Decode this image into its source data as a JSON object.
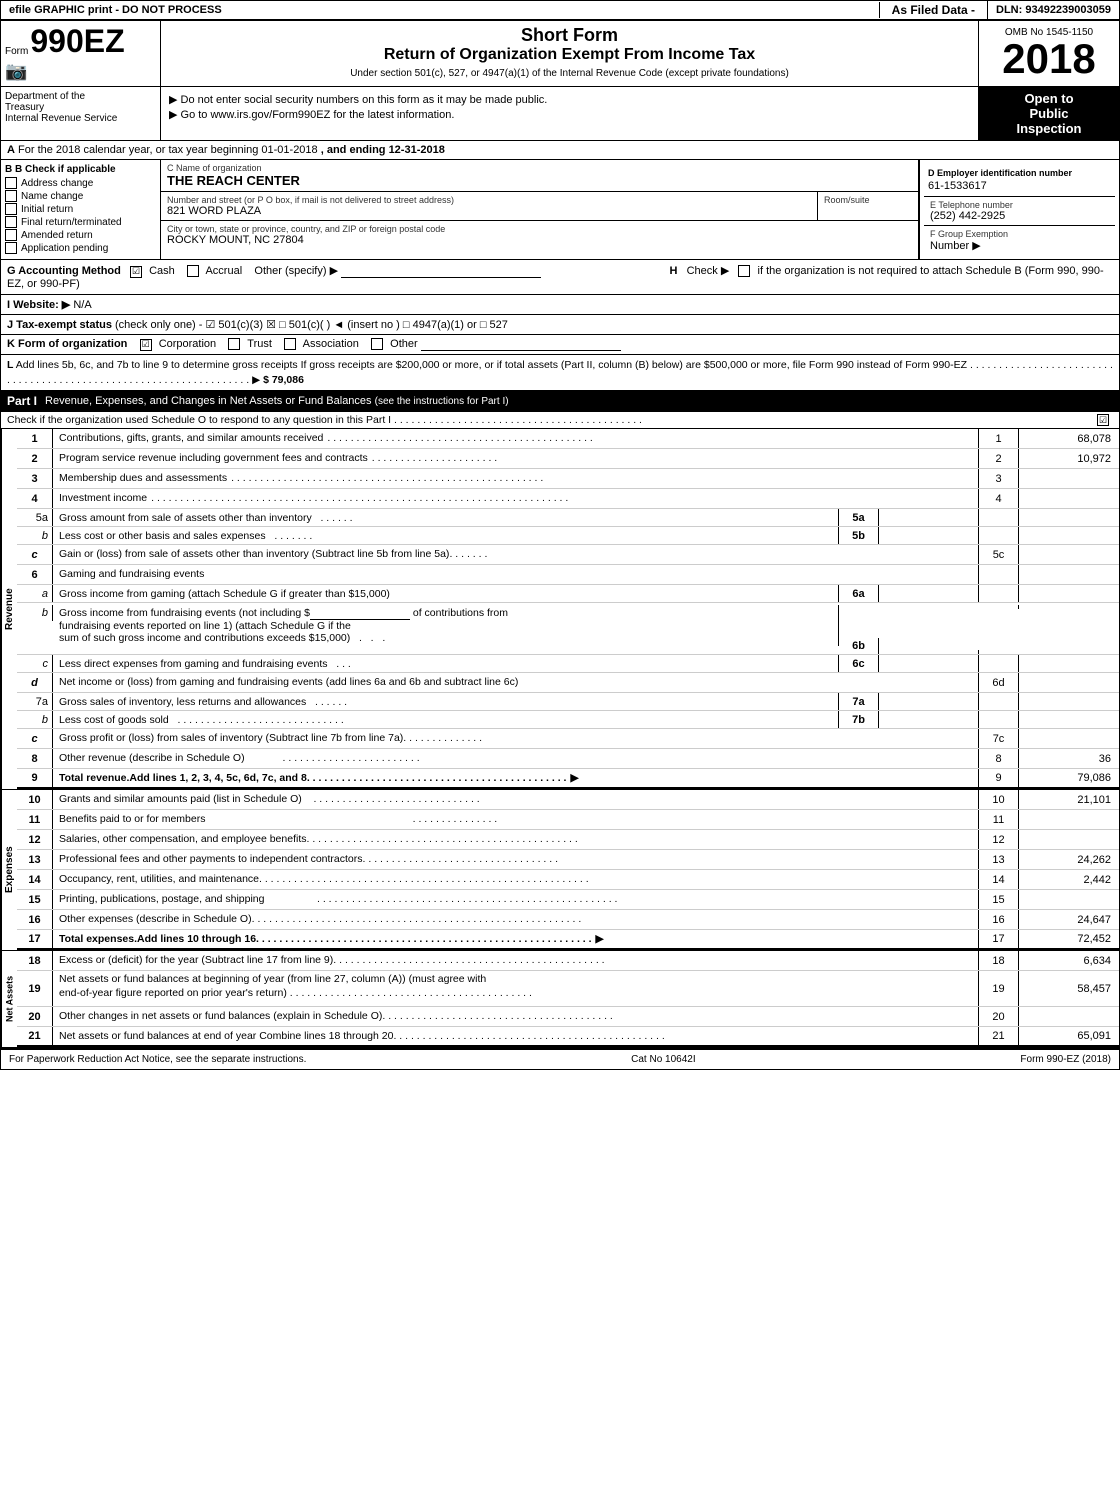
{
  "header": {
    "left_text": "efile GRAPHIC print - DO NOT PROCESS",
    "mid_text": "As Filed Data -",
    "dln": "DLN: 93492239003059"
  },
  "form": {
    "form_label": "Form",
    "form_number": "990EZ",
    "short_form": "Short Form",
    "return_title": "Return of Organization Exempt From Income Tax",
    "subtitle": "Under section 501(c), 527, or 4947(a)(1) of the Internal Revenue Code (except private foundations)",
    "omb_label": "OMB No 1545-1150",
    "year": "2018",
    "open_to": "Open to",
    "public": "Public",
    "inspection": "Inspection"
  },
  "notices": {
    "ssn_notice": "▶ Do not enter social security numbers on this form as it may be made public.",
    "irs_link": "▶ Go to www.irs.gov/Form990EZ for the latest information."
  },
  "section_a": {
    "label": "A",
    "text": "For the 2018 calendar year, or tax year beginning 01-01-2018",
    "ending": ", and ending 12-31-2018"
  },
  "check_applicable": {
    "label": "B Check if applicable",
    "items": [
      {
        "label": "Address change",
        "checked": false
      },
      {
        "label": "Name change",
        "checked": false
      },
      {
        "label": "Initial return",
        "checked": false
      },
      {
        "label": "Final return/terminated",
        "checked": false
      },
      {
        "label": "Amended return",
        "checked": false
      },
      {
        "label": "Application pending",
        "checked": false
      }
    ]
  },
  "org": {
    "name_label": "C Name of organization",
    "name": "THE REACH CENTER",
    "address_label": "Number and street (or P O box, if mail is not delivered to street address)",
    "address": "821 WORD PLAZA",
    "room_label": "Room/suite",
    "room": "",
    "city_label": "City or town, state or province, country, and ZIP or foreign postal code",
    "city": "ROCKY MOUNT, NC  27804",
    "ein_label": "D Employer identification number",
    "ein": "61-1533617",
    "phone_label": "E Telephone number",
    "phone": "(252) 442-2925",
    "fgroup_label": "F Group Exemption",
    "fgroup_num": "Number",
    "fgroup_arrow": "▶"
  },
  "accounting": {
    "g_label": "G Accounting Method",
    "cash_label": "Cash",
    "accrual_label": "Accrual",
    "other_label": "Other (specify) ▶",
    "cash_checked": true,
    "accrual_checked": false,
    "h_label": "H",
    "h_text": "Check ▶",
    "h_desc": "if the organization is not required to attach Schedule B (Form 990, 990-EZ, or 990-PF)"
  },
  "website": {
    "label": "I Website: ▶",
    "value": "N/A"
  },
  "tax_exempt": {
    "j_label": "J Tax-exempt status",
    "j_text": "(check only one) - ☑ 501(c)(3) ☒ □ 501(c)(  ) ◄ (insert no ) □ 4947(a)(1) or □ 527"
  },
  "form_org": {
    "k_label": "K Form of organization",
    "corporation": "Corporation",
    "trust": "Trust",
    "association": "Association",
    "other": "Other",
    "corp_checked": true
  },
  "add_lines": {
    "l_label": "L",
    "l_text": "Add lines 5b, 6c, and 7b to line 9 to determine gross receipts If gross receipts are $200,000 or more, or if total assets (Part II, column (B) below) are $500,000 or more, file Form 990 instead of Form 990-EZ",
    "l_dots": ". . . . . . . . . . . . . . . . . . . . . . . . . . . . . . . . . . . . . . . . . . . . . . . . . . . . . . . . . . . . . . . . . . .",
    "l_arrow": "▶",
    "l_value": "$ 79,086"
  },
  "part1": {
    "label": "Part I",
    "title": "Revenue, Expenses, and Changes in Net Assets or Fund Balances",
    "title_note": "(see the instructions for Part I)",
    "schedule_o_text": "Check if the organization used Schedule O to respond to any question in this Part I",
    "schedule_o_dots": ". . . . . . . . . . . . . . . . . . . . . . . . . . . . . . . . . . . . . . . . . . .",
    "schedule_o_checked": true
  },
  "revenue_rows": [
    {
      "num": "1",
      "desc": "Contributions, gifts, grants, and similar amounts received",
      "dots": ". . . . . . . . . . . . . . . . . . . . . . . . . . . . . . . .",
      "line_num": "1",
      "value": "68,078"
    },
    {
      "num": "2",
      "desc": "Program service revenue including government fees and contracts",
      "dots": ". . . . . . . . . . . . . . . . . . . . . . . .",
      "line_num": "2",
      "value": "10,972"
    },
    {
      "num": "3",
      "desc": "Membership dues and assessments",
      "dots": ". . . . . . . . . . . . . . . . . . . . . . . . . . . . . . . . . . . . . . . . . . . . . . . . . . . . . . . . .",
      "line_num": "3",
      "value": ""
    },
    {
      "num": "4",
      "desc": "Investment income",
      "dots": ". . . . . . . . . . . . . . . . . . . . . . . . . . . . . . . . . . . . . . . . . . . . . . . . . . . . . . . . . . . . . . . . . . . . . . . . .",
      "line_num": "4",
      "value": ""
    }
  ],
  "row_5a": {
    "num": "5a",
    "desc": "Gross amount from sale of assets other than inventory",
    "label": "5a",
    "value": ""
  },
  "row_5b": {
    "num": "b",
    "desc": "Less  cost or other basis and sales expenses",
    "label": "5b",
    "value": ""
  },
  "row_5c": {
    "num": "c",
    "desc": "Gain or (loss) from sale of assets other than inventory (Subtract line 5b from line 5a)",
    "dots": ". . . . . . . .",
    "line_num": "5c",
    "value": ""
  },
  "row_6": {
    "num": "6",
    "desc": "Gaming and fundraising events"
  },
  "row_6a": {
    "num": "a",
    "desc": "Gross income from gaming (attach Schedule G if greater than $15,000)",
    "label": "6a",
    "value": ""
  },
  "row_6b_text": "Gross income from fundraising events (not including $",
  "row_6b_text2": "of contributions from",
  "row_6b_text3": "fundraising events reported on line 1) (attach Schedule G if the",
  "row_6b_text4": "sum of such gross income and contributions exceeds $15,000)",
  "row_6b_label": "6b",
  "row_6c": {
    "num": "c",
    "desc": "Less  direct expenses from gaming and fundraising events",
    "dots": ". . .",
    "label": "6c",
    "value": ""
  },
  "row_6d": {
    "num": "d",
    "desc": "Net income or (loss) from gaming and fundraising events (add lines 6a and 6b and subtract line 6c)",
    "line_num": "6d",
    "value": ""
  },
  "row_7a": {
    "num": "7a",
    "desc": "Gross sales of inventory, less returns and allowances",
    "dots": ". . . . . . . .",
    "label": "7a",
    "value": ""
  },
  "row_7b": {
    "num": "b",
    "desc": "Less  cost of goods sold",
    "dots": ". . . . . . . . . . . . . . . . . . . . . . . . . . . . .",
    "label": "7b",
    "value": ""
  },
  "row_7c": {
    "num": "c",
    "desc": "Gross profit or (loss) from sales of inventory (Subtract line 7b from line 7a)",
    "dots": ". . . . . . . . . . . . . .",
    "line_num": "7c",
    "value": ""
  },
  "row_8": {
    "num": "8",
    "desc": "Other revenue (describe in Schedule O)",
    "dots": ". . . . . . . . . . . . . . . . . . . . . . . .",
    "line_num": "8",
    "value": "36"
  },
  "row_9": {
    "num": "9",
    "desc": "Total revenue.",
    "desc2": "Add lines 1, 2, 3, 4, 5c, 6d, 7c, and 8",
    "dots": ". . . . . . . . . . . . . . . . . . . . . . . . . . . . . . . . . . . . . . . . . . . .",
    "arrow": "▶",
    "line_num": "9",
    "value": "79,086"
  },
  "expense_rows": [
    {
      "num": "10",
      "desc": "Grants and similar amounts paid (list in Schedule O)",
      "dots": ". . . . . . . . . . . . . . . . . . . . . . . . . . . . . .",
      "line_num": "10",
      "value": "21,101"
    },
    {
      "num": "11",
      "desc": "Benefits paid to or for members",
      "dots": ". . . . . . . . . . . . . . . . . . . . . . . . . . . . . . . . . . . . . . . . . . . . . . . . . . . . . . . . . . . . . . . . .",
      "line_num": "11",
      "value": ""
    },
    {
      "num": "12",
      "desc": "Salaries, other compensation, and employee benefits",
      "dots": ". . . . . . . . . . . . . . . . . . . . . . . . . . . . . . . . . . . . . . . . . . . . . . . .",
      "line_num": "12",
      "value": ""
    },
    {
      "num": "13",
      "desc": "Professional fees and other payments to independent contractors",
      "dots": ". . . . . . . . . . . . . . . . . . . . . . . . . . . . . . . . . . .",
      "line_num": "13",
      "value": "24,262"
    },
    {
      "num": "14",
      "desc": "Occupancy, rent, utilities, and maintenance",
      "dots": ". . . . . . . . . . . . . . . . . . . . . . . . . . . . . . . . . . . . . . . . . . . . . . . . . . . . . . . . .",
      "line_num": "14",
      "value": "2,442"
    },
    {
      "num": "15",
      "desc": "Printing, publications, postage, and shipping",
      "dots": ". . . . . . . . . . . . . . . . . . . . . . . . . . . . . . . . . . . . . . . . . . . . . . . . . . . . . . .",
      "line_num": "15",
      "value": ""
    },
    {
      "num": "16",
      "desc": "Other expenses (describe in Schedule O)",
      "dots": ". . . . . . . . . . . . . . . . . . . . . . . . . . . . . . . . . . . . . . . . . . . . . . . . . . . . . . . . .",
      "line_num": "16",
      "value": "24,647"
    },
    {
      "num": "17",
      "desc": "Total expenses.",
      "desc2": "Add lines 10 through 16",
      "dots": ". . . . . . . . . . . . . . . . . . . . . . . . . . . . . . . . . . . . . . . . . . . . . . . . . . . . . . . . . .",
      "arrow": "▶",
      "line_num": "17",
      "value": "72,452",
      "bold": true
    }
  ],
  "net_assets_rows": [
    {
      "num": "18",
      "desc": "Excess or (deficit) for the year (Subtract line 17 from line 9)",
      "dots": ". . . . . . . . . . . . . . . . . . . . . . . . . . . . . . . . . . . . . . . . . . . . . . . .",
      "line_num": "18",
      "value": "6,634"
    },
    {
      "num": "19",
      "desc": "Net assets or fund balances at beginning of year (from line 27, column (A)) (must agree with end-of-year figure reported on prior year's return)",
      "dots": ". . . . . . . . . . . . . . . . . . . . . . . . . . . . . . . . . . . . . . . . . .",
      "line_num": "19",
      "value": "58,457"
    },
    {
      "num": "20",
      "desc": "Other changes in net assets or fund balances (explain in Schedule O)",
      "dots": ". . . . . . . . . . . . . . . . . . . . . . . . . . . . . . . . . . . . . . . . .",
      "line_num": "20",
      "value": ""
    },
    {
      "num": "21",
      "desc": "Net assets or fund balances at end of year  Combine lines 18 through 20",
      "dots": ". . . . . . . . . . . . . . . . . . . . . . . . . . . . . . . . . . . . . . . . . . . . . . .",
      "line_num": "21",
      "value": "65,091"
    }
  ],
  "footer": {
    "left": "For Paperwork Reduction Act Notice, see the separate instructions.",
    "mid": "Cat No 10642I",
    "right": "Form 990-EZ (2018)"
  }
}
